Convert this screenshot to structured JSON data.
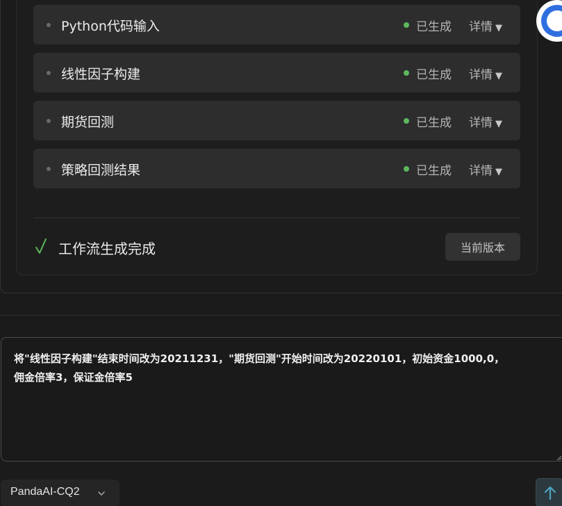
{
  "workflow": {
    "steps": [
      {
        "name": "Python代码输入",
        "status": "已生成",
        "details": "详情"
      },
      {
        "name": "线性因子构建",
        "status": "已生成",
        "details": "详情"
      },
      {
        "name": "期货回测",
        "status": "已生成",
        "details": "详情"
      },
      {
        "name": "策略回测结果",
        "status": "已生成",
        "details": "详情"
      }
    ],
    "complete_text": "工作流生成完成",
    "version_button": "当前版本"
  },
  "prompt": {
    "value": "将\"线性因子构建\"结束时间改为20211231，\"期货回测\"开始时间改为20220101，初始资金1000,0，\n佣金倍率3，保证金倍率5"
  },
  "model_select": {
    "selected": "PandaAI-CQ2"
  },
  "colors": {
    "status_green": "#5cb85c",
    "send_accent": "#4fa3c0",
    "logo_blue": "#2f6fe0"
  }
}
